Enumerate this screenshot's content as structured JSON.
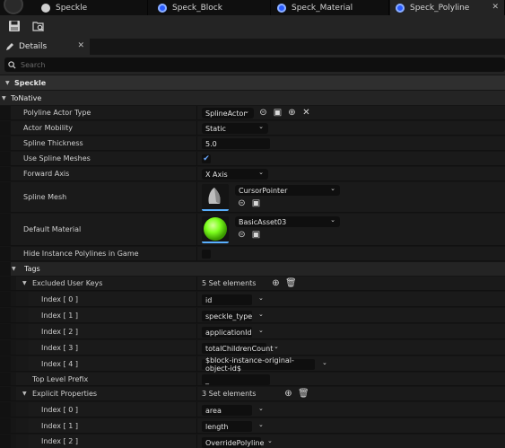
{
  "tabs": [
    {
      "label": "Speckle",
      "icon": "unreal-logo-icon"
    },
    {
      "label": "Speck_Block",
      "icon": "blueprint-icon"
    },
    {
      "label": "Speck_Material",
      "icon": "blueprint-icon"
    },
    {
      "label": "Speck_Polyline",
      "icon": "blueprint-icon",
      "active": true
    }
  ],
  "panel": {
    "tab_label": "Details",
    "close": "✕"
  },
  "search": {
    "placeholder": "Search"
  },
  "categories": {
    "speckle": "Speckle",
    "to_native": "ToNative",
    "tags": "Tags"
  },
  "props": {
    "polyline_actor_type": {
      "label": "Polyline Actor Type",
      "value": "SplineActor"
    },
    "actor_mobility": {
      "label": "Actor Mobility",
      "value": "Static"
    },
    "spline_thickness": {
      "label": "Spline Thickness",
      "value": "5.0"
    },
    "use_spline_meshes": {
      "label": "Use Spline Meshes",
      "checked": true
    },
    "forward_axis": {
      "label": "Forward Axis",
      "value": "X Axis"
    },
    "spline_mesh": {
      "label": "Spline Mesh",
      "value": "CursorPointer"
    },
    "default_material": {
      "label": "Default Material",
      "value": "BasicAsset03"
    },
    "hide_instance_polylines": {
      "label": "Hide Instance Polylines in Game",
      "checked": false
    },
    "excluded_user_keys": {
      "label": "Excluded User Keys",
      "count_text": "5 Set elements",
      "items": [
        {
          "index": "Index [ 0 ]",
          "value": "id"
        },
        {
          "index": "Index [ 1 ]",
          "value": "speckle_type"
        },
        {
          "index": "Index [ 2 ]",
          "value": "applicationId"
        },
        {
          "index": "Index [ 3 ]",
          "value": "totalChildrenCount"
        },
        {
          "index": "Index [ 4 ]",
          "value": "$block-instance-original-object-id$"
        }
      ]
    },
    "top_level_prefix": {
      "label": "Top Level Prefix",
      "value": "_"
    },
    "explicit_properties": {
      "label": "Explicit Properties",
      "count_text": "3 Set elements",
      "items": [
        {
          "index": "Index [ 0 ]",
          "value": "area"
        },
        {
          "index": "Index [ 1 ]",
          "value": "length"
        },
        {
          "index": "Index [ 2 ]",
          "value": "OverridePolyline"
        }
      ]
    }
  },
  "colors": {
    "accent": "#2b5cff",
    "check": "#6aa8ff",
    "material_sphere": "#7dff1e"
  }
}
